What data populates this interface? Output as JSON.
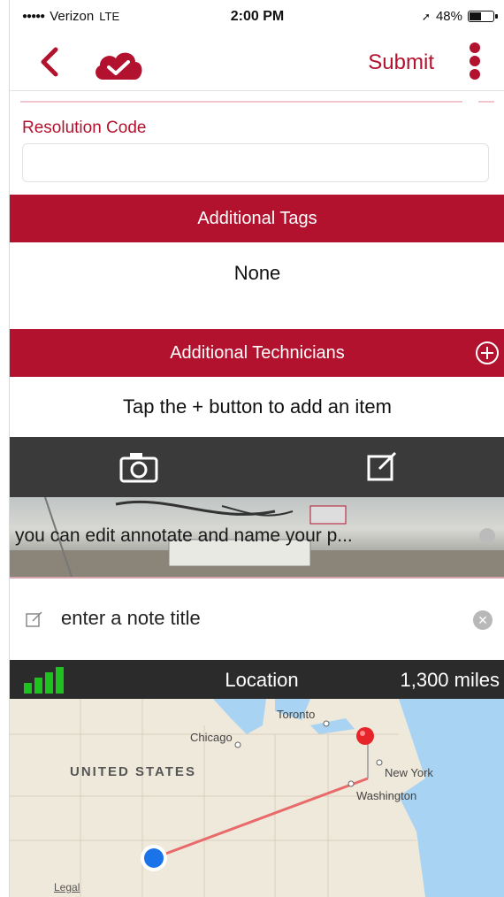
{
  "status_bar": {
    "carrier": "Verizon",
    "network": "LTE",
    "time": "2:00 PM",
    "battery": "48%",
    "battery_level": 0.48
  },
  "nav": {
    "submit_label": "Submit"
  },
  "form": {
    "resolution_code_label": "Resolution Code",
    "resolution_code_value": "",
    "additional_tags_header": "Additional Tags",
    "additional_tags_value": "None",
    "additional_technicians_header": "Additional Technicians",
    "technicians_hint": "Tap the + button to add an item"
  },
  "photo": {
    "caption": "you can edit annotate and name your p..."
  },
  "note": {
    "title_placeholder": "enter a note title"
  },
  "location": {
    "label": "Location",
    "distance": "1,300 miles"
  },
  "map": {
    "country_label": "UNITED STATES",
    "cities": [
      "Toronto",
      "Chicago",
      "New York",
      "Washington"
    ],
    "legal": "Legal"
  },
  "colors": {
    "brand_red": "#b3122e",
    "dark_bar": "#3a3a3a",
    "signal_green": "#1ec21e",
    "route": "#e86a6a",
    "current_location": "#1a73e8"
  },
  "icons": {
    "back": "chevron-left-icon",
    "sync": "cloud-check-icon",
    "more": "vertical-dots-icon",
    "add": "plus-circle-icon",
    "camera": "camera-icon",
    "edit": "edit-note-icon",
    "signal": "signal-bars-icon",
    "clear": "clear-icon"
  }
}
